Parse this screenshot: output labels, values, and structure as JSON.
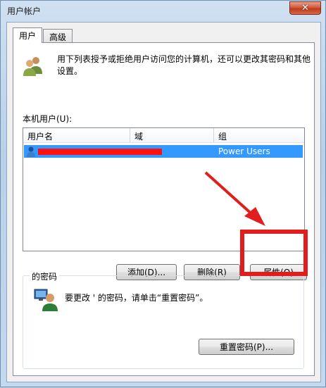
{
  "window": {
    "title": "用户帐户",
    "close_glyph": "✕"
  },
  "tabs": [
    {
      "label": "用户"
    },
    {
      "label": "高级"
    }
  ],
  "intro": {
    "text_line1": "用下列表授予或拒绝用户访问您的计算机，还可以更改其密码和其他",
    "text_line2": "设置。"
  },
  "users": {
    "label": "本机用户(U):",
    "columns": [
      "用户名",
      "域",
      "组"
    ],
    "rows": [
      {
        "username": "",
        "domain": "",
        "group": "Power Users"
      }
    ],
    "buttons": {
      "add": "添加(D)...",
      "remove": "删除(R)",
      "properties": "属性(O)"
    }
  },
  "password_group": {
    "label": "的密码",
    "message": "要更改  '  的密码，请单击“重置密码”。",
    "reset_button": "重置密码(P)..."
  },
  "annotation": {
    "highlight_color": "#e21d1d"
  }
}
